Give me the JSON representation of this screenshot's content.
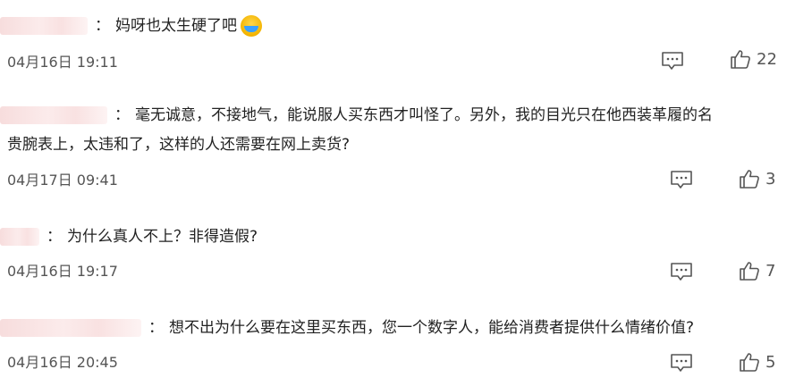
{
  "comments": [
    {
      "text": "妈呀也太生硬了吧",
      "emoji": "crying-laughing-emoji",
      "timestamp": "04月16日 19:11",
      "likes": "22"
    },
    {
      "text_line1": "毫无诚意，不接地气，能说服人买东西才叫怪了。另外，我的目光只在他西装革履的名",
      "text_line2": "贵腕表上，太违和了，这样的人还需要在网上卖货?",
      "timestamp": "04月17日 09:41",
      "likes": "3"
    },
    {
      "text": "为什么真人不上？非得造假?",
      "timestamp": "04月16日 19:17",
      "likes": "7"
    },
    {
      "text": "想不出为什么要在这里买东西，您一个数字人，能给消费者提供什么情绪价值?",
      "timestamp": "04月16日 20:45",
      "likes": "5"
    }
  ],
  "separator": "：",
  "icons": {
    "reply": "comment-bubble-icon",
    "like": "thumbs-up-icon"
  },
  "colors": {
    "text": "#222222",
    "meta": "#555555",
    "username_blur": "#f6d9d9"
  }
}
